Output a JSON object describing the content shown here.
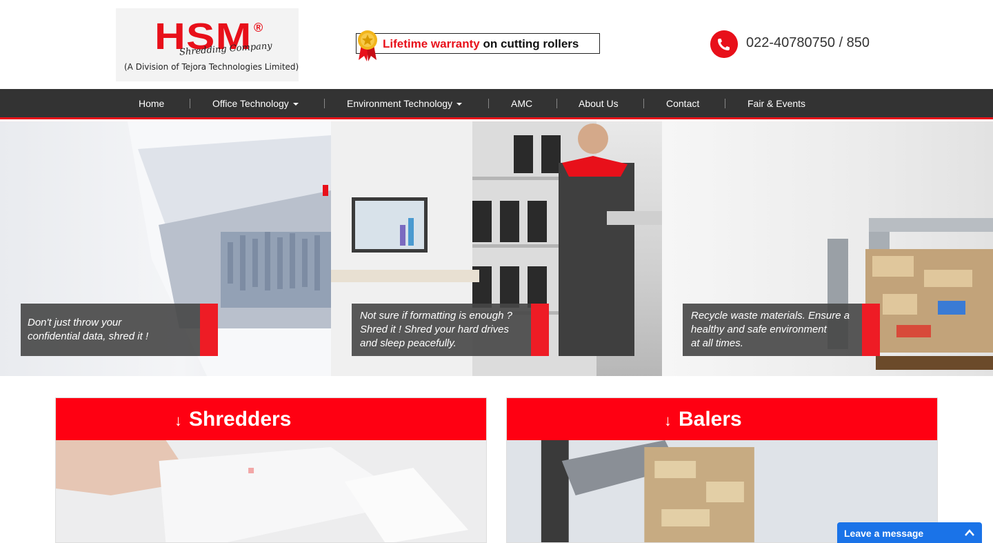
{
  "header": {
    "logo": {
      "brand": "HSM",
      "registered": "®",
      "tagline": "Shredding Company",
      "division": "(A Division of Tejora Technologies Limited)"
    },
    "warranty": {
      "highlight": "Lifetime warranty",
      "rest": "on cutting rollers"
    },
    "phone": "022-40780750 / 850"
  },
  "nav": {
    "items": [
      {
        "label": "Home",
        "dropdown": false
      },
      {
        "label": "Office Technology",
        "dropdown": true
      },
      {
        "label": "Environment Technology",
        "dropdown": true
      },
      {
        "label": "AMC",
        "dropdown": false
      },
      {
        "label": "About Us",
        "dropdown": false
      },
      {
        "label": "Contact",
        "dropdown": false
      },
      {
        "label": "Fair & Events",
        "dropdown": false
      }
    ]
  },
  "hero": {
    "panels": [
      {
        "caption": "Don't just throw your\nconfidential data, shred it !"
      },
      {
        "caption": "Not sure if formatting is enough ?\nShred it ! Shred your hard drives\nand sleep peacefully."
      },
      {
        "caption": "Recycle waste materials. Ensure a\nhealthy and safe environment\nat all times."
      }
    ]
  },
  "categories": [
    {
      "arrow": "↓",
      "title": "Shredders"
    },
    {
      "arrow": "↓",
      "title": "Balers"
    }
  ],
  "chat": {
    "label": "Leave a message"
  },
  "colors": {
    "brand_red": "#e8101a",
    "nav_bg": "#333333",
    "category_red": "#ff0012",
    "chat_blue": "#1a73e8"
  }
}
